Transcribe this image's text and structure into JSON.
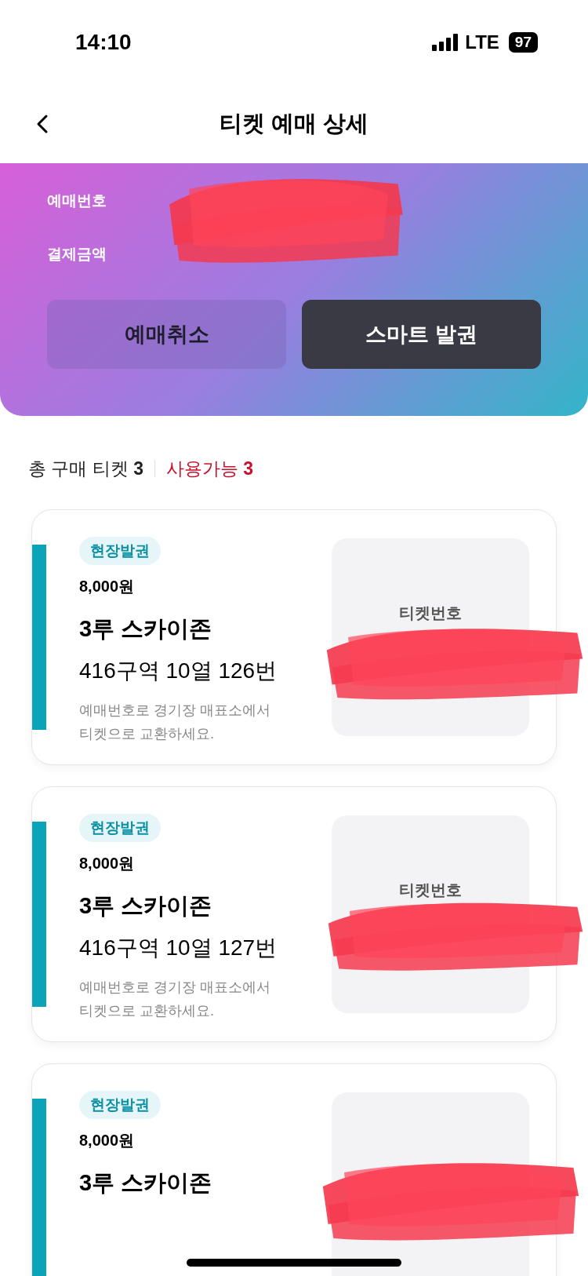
{
  "status_bar": {
    "time": "14:10",
    "network": "LTE",
    "battery": "97"
  },
  "header": {
    "title": "티켓 예매 상세"
  },
  "booking": {
    "fields": [
      {
        "label": "예매번호"
      },
      {
        "label": "결제금액"
      }
    ],
    "buttons": [
      {
        "label": "예매취소",
        "kind": "secondary"
      },
      {
        "label": "스마트 발권",
        "kind": "primary"
      }
    ]
  },
  "summary": {
    "total_label": "총 구매 티켓",
    "total": "3",
    "usable_label": "사용가능",
    "usable": "3"
  },
  "tickets": [
    {
      "badge": "현장발권",
      "price": "8,000원",
      "zone": "3루 스카이존",
      "seat": "416구역 10열 126번",
      "note_lines": [
        "예매번호로 경기장 매표소에서",
        "티켓으로 교환하세요."
      ],
      "ticket_label": "티켓번호"
    },
    {
      "badge": "현장발권",
      "price": "8,000원",
      "zone": "3루 스카이존",
      "seat": "416구역 10열 127번",
      "note_lines": [
        "예매번호로 경기장 매표소에서",
        "티켓으로 교환하세요."
      ],
      "ticket_label": "티켓번호"
    },
    {
      "badge": "현장발권",
      "price": "8,000원",
      "zone": "3루 스카이존"
    }
  ]
}
